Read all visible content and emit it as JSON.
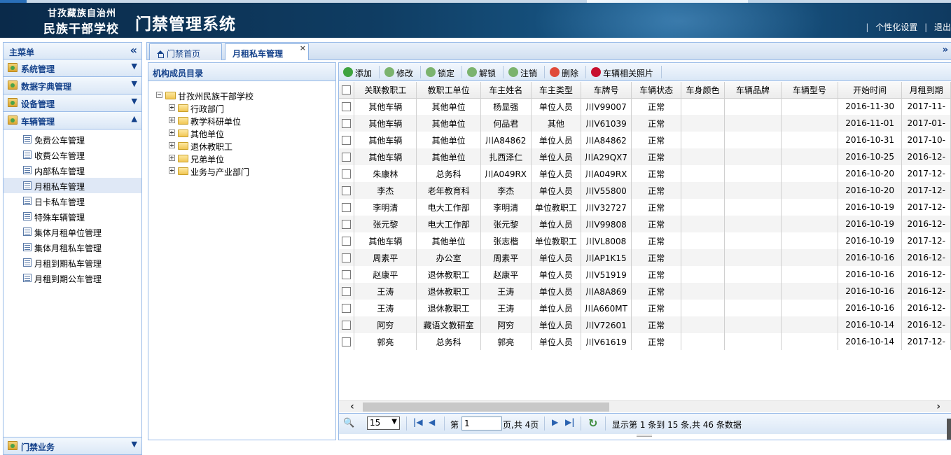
{
  "header": {
    "school_line1": "甘孜藏族自治州",
    "school_line2": "民族干部学校",
    "system_title": "门禁管理系统",
    "sep1": "|",
    "personal_settings": "个性化设置",
    "sep2": "|",
    "logout": "退出"
  },
  "sidebar": {
    "title": "主菜单",
    "collapse_icon": "«",
    "menus": [
      {
        "label": "系统管理",
        "arrow": "▼"
      },
      {
        "label": "数据字典管理",
        "arrow": "▼"
      },
      {
        "label": "设备管理",
        "arrow": "▼"
      },
      {
        "label": "车辆管理",
        "arrow": "▲"
      }
    ],
    "sub_items": [
      "免费公车管理",
      "收费公车管理",
      "内部私车管理",
      "月租私车管理",
      "日卡私车管理",
      "特殊车辆管理",
      "集体月租单位管理",
      "集体月租私车管理",
      "月租到期私车管理",
      "月租到期公车管理"
    ],
    "bottom_menu": {
      "label": "门禁业务",
      "arrow": "▼"
    }
  },
  "tabs": {
    "home": "门禁首页",
    "active": "月租私车管理",
    "close": "×",
    "more": "»"
  },
  "tree": {
    "title": "机构成员目录",
    "root": "甘孜州民族干部学校",
    "children": [
      "行政部门",
      "教学科研单位",
      "其他单位",
      "退休教职工",
      "兄弟单位",
      "业务与产业部门"
    ]
  },
  "toolbar": {
    "add": "添加",
    "edit": "修改",
    "lock": "锁定",
    "unlock": "解锁",
    "cancel": "注销",
    "delete": "删除",
    "photos": "车辆相关照片"
  },
  "table": {
    "columns": [
      "关联教职工",
      "教职工单位",
      "车主姓名",
      "车主类型",
      "车牌号",
      "车辆状态",
      "车身颜色",
      "车辆品牌",
      "车辆型号",
      "开始时间",
      "月租到期"
    ],
    "rows": [
      [
        "其他车辆",
        "其他单位",
        "杨显强",
        "单位人员",
        "川V99007",
        "正常",
        "",
        "",
        "",
        "2016-11-30",
        "2017-11-"
      ],
      [
        "其他车辆",
        "其他单位",
        "何品君",
        "其他",
        "川V61039",
        "正常",
        "",
        "",
        "",
        "2016-11-01",
        "2017-01-"
      ],
      [
        "其他车辆",
        "其他单位",
        "川A84862",
        "单位人员",
        "川A84862",
        "正常",
        "",
        "",
        "",
        "2016-10-31",
        "2017-10-"
      ],
      [
        "其他车辆",
        "其他单位",
        "扎西泽仁",
        "单位人员",
        "川A29QX7",
        "正常",
        "",
        "",
        "",
        "2016-10-25",
        "2016-12-"
      ],
      [
        "朱康林",
        "总务科",
        "川A049RX",
        "单位人员",
        "川A049RX",
        "正常",
        "",
        "",
        "",
        "2016-10-20",
        "2017-12-"
      ],
      [
        "李杰",
        "老年教育科",
        "李杰",
        "单位人员",
        "川V55800",
        "正常",
        "",
        "",
        "",
        "2016-10-20",
        "2017-12-"
      ],
      [
        "李明清",
        "电大工作部",
        "李明清",
        "单位教职工",
        "川V32727",
        "正常",
        "",
        "",
        "",
        "2016-10-19",
        "2017-12-"
      ],
      [
        "张元黎",
        "电大工作部",
        "张元黎",
        "单位人员",
        "川V99808",
        "正常",
        "",
        "",
        "",
        "2016-10-19",
        "2016-12-"
      ],
      [
        "其他车辆",
        "其他单位",
        "张志楷",
        "单位教职工",
        "川VL8008",
        "正常",
        "",
        "",
        "",
        "2016-10-19",
        "2017-12-"
      ],
      [
        "周素平",
        "办公室",
        "周素平",
        "单位人员",
        "川AP1K15",
        "正常",
        "",
        "",
        "",
        "2016-10-16",
        "2016-12-"
      ],
      [
        "赵康平",
        "退休教职工",
        "赵康平",
        "单位人员",
        "川V51919",
        "正常",
        "",
        "",
        "",
        "2016-10-16",
        "2016-12-"
      ],
      [
        "王涛",
        "退休教职工",
        "王涛",
        "单位人员",
        "川A8A869",
        "正常",
        "",
        "",
        "",
        "2016-10-16",
        "2016-12-"
      ],
      [
        "王涛",
        "退休教职工",
        "王涛",
        "单位人员",
        "川A660MT",
        "正常",
        "",
        "",
        "",
        "2016-10-16",
        "2016-12-"
      ],
      [
        "阿穷",
        "藏语文教研室",
        "阿穷",
        "单位人员",
        "川V72601",
        "正常",
        "",
        "",
        "",
        "2016-10-14",
        "2016-12-"
      ],
      [
        "郭亮",
        "总务科",
        "郭亮",
        "单位人员",
        "川V61619",
        "正常",
        "",
        "",
        "",
        "2016-10-14",
        "2017-12-"
      ]
    ]
  },
  "pager": {
    "page_size": "15",
    "page_prefix": "第",
    "page_value": "1",
    "page_suffix": "页,共 4页",
    "summary": "显示第 1 条到 15 条,共 46 条数据"
  }
}
